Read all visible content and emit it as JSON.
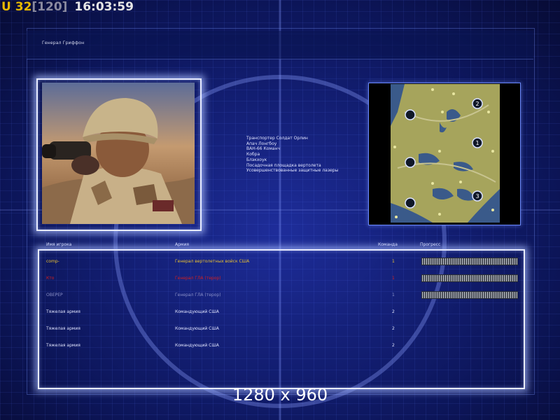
{
  "hud": {
    "prefix": "U",
    "fps": "32",
    "max_fps": "[120]",
    "clock": "16:03:59"
  },
  "header": {
    "general_name": "Генерал Гриффон"
  },
  "unit_list": [
    "Транспортер Солдат Орлин",
    "Апач Лонгбоу",
    "ВАН-66 Команч",
    "Кобра",
    "Блэкхоук",
    "Посадочная площадка вертолета",
    "Усовершенствованные защитные лазеры"
  ],
  "table": {
    "headers": {
      "player": "Имя игрока",
      "army": "Армия",
      "team": "Команда",
      "progress": "Прогресс"
    },
    "rows": [
      {
        "player": "comp-",
        "army": "Генерал вертолетных войск США",
        "team": "1",
        "color": "#e8c030",
        "progress": 1.0
      },
      {
        "player": "Кто",
        "army": "Генерал ГЛА (терор)",
        "team": "1",
        "color": "#d42020",
        "progress": 1.0
      },
      {
        "player": "ОВЕРЕР",
        "army": "Генерал ГЛА (терор)",
        "team": "1",
        "color": "#8a90c8",
        "progress": 1.0
      },
      {
        "player": "Тяжелая армия",
        "army": "Командующий США",
        "team": "2",
        "color": "#e0e4ff",
        "progress": null
      },
      {
        "player": "Тяжелая армия",
        "army": "Командующий США",
        "team": "2",
        "color": "#e0e4ff",
        "progress": null
      },
      {
        "player": "Тяжелая армия",
        "army": "Командующий США",
        "team": "2",
        "color": "#e0e4ff",
        "progress": null
      }
    ]
  },
  "map": {
    "start_positions": [
      "",
      "2",
      "",
      "1",
      "",
      "3",
      ""
    ]
  },
  "footer": {
    "resolution": "1280 x 960"
  }
}
